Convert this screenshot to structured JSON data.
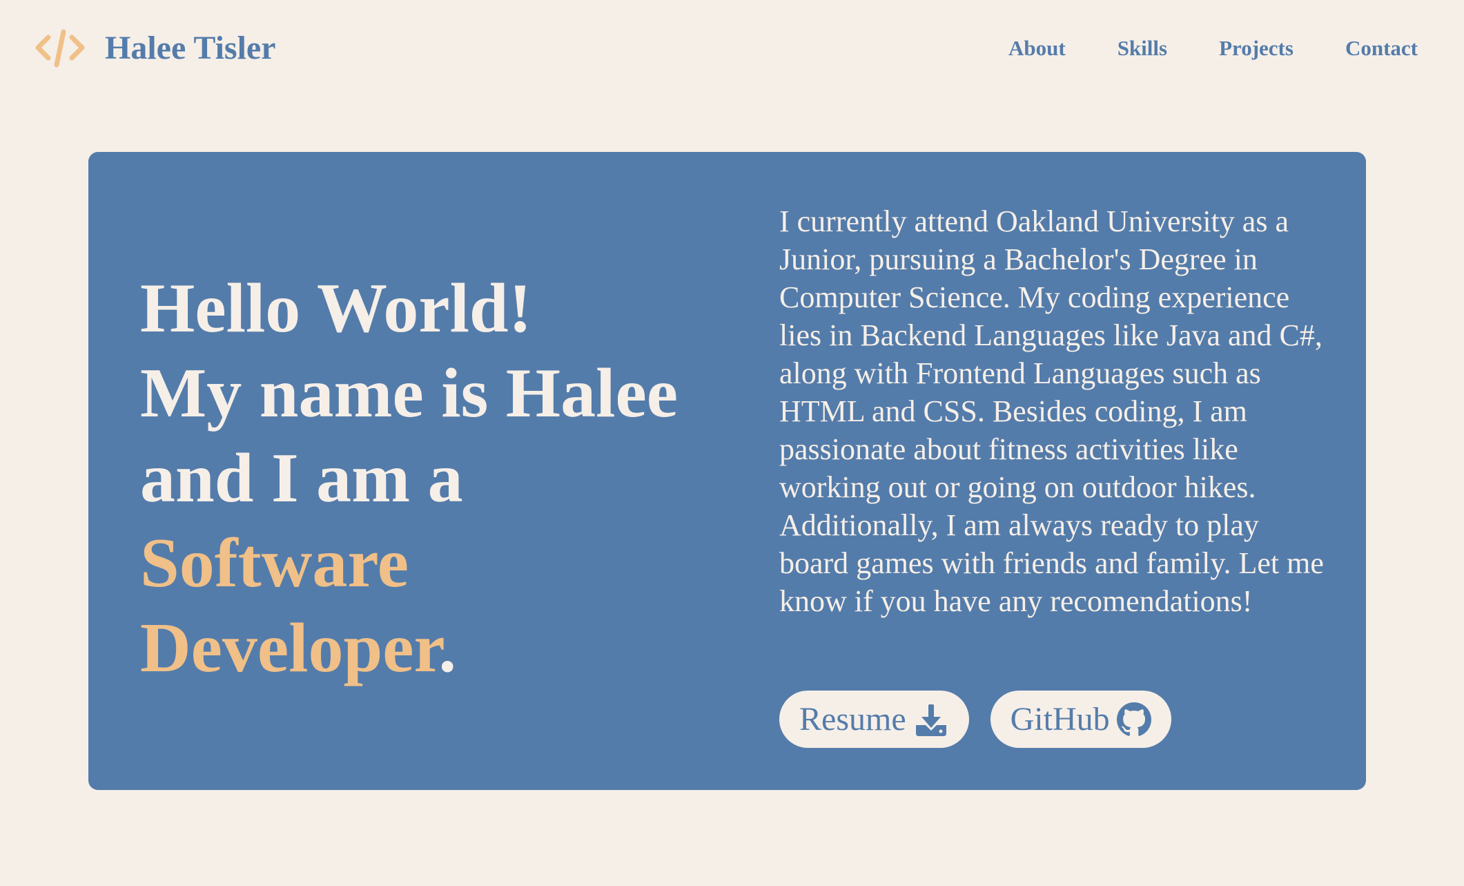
{
  "brand": {
    "icon": "code-brackets-icon",
    "name": "Halee Tisler"
  },
  "nav": {
    "items": [
      {
        "label": "About"
      },
      {
        "label": "Skills"
      },
      {
        "label": "Projects"
      },
      {
        "label": "Contact"
      }
    ]
  },
  "hero": {
    "headline": {
      "line1": "Hello World!",
      "line2": "My name is Halee",
      "line3": "and I am a",
      "highlight1": "Software",
      "highlight2": "Developer",
      "end_punct": "."
    },
    "bio": "I currently attend Oakland University as a Junior, pursuing a Bachelor's Degree in Computer Science. My coding experience lies in Backend Languages like Java and C#, along with Frontend Languages such as HTML and CSS. Besides coding, I am passionate about fitness activities like working out or going on outdoor hikes. Additionally, I am always ready to play board games with friends and family. Let me know if you have any recomendations!",
    "buttons": {
      "resume": {
        "label": "Resume",
        "icon": "download-icon"
      },
      "github": {
        "label": "GitHub",
        "icon": "github-icon"
      }
    }
  },
  "colors": {
    "background": "#f6efe8",
    "primary": "#547caa",
    "accent": "#f0c088"
  }
}
